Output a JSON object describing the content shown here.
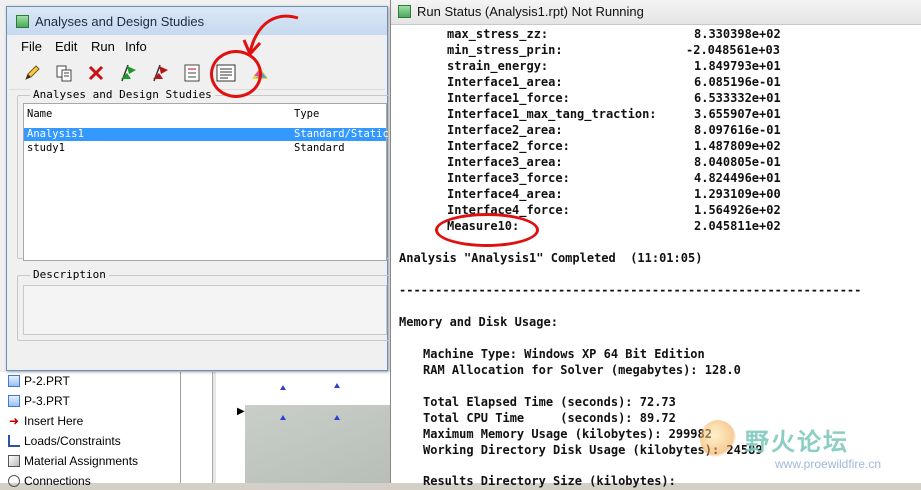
{
  "dialog": {
    "title": "Analyses and Design Studies",
    "menus": [
      "File",
      "Edit",
      "Run",
      "Info"
    ],
    "toolbar_icons": [
      "pencil-icon",
      "copy-icon",
      "delete-icon",
      "green-flag-icon",
      "red-flag-icon",
      "list-icon",
      "status-icon",
      "results-icon"
    ],
    "studies_group_label": "Analyses and Design Studies",
    "columns": [
      "Name",
      "Type"
    ],
    "rows": [
      {
        "name": "Analysis1",
        "type": "Standard/Static",
        "selected": true
      },
      {
        "name": "study1",
        "type": "Standard",
        "selected": false
      }
    ],
    "description_label": "Description"
  },
  "model_tree": {
    "items": [
      {
        "label": "P-2.PRT",
        "icon": "part-icon"
      },
      {
        "label": "P-3.PRT",
        "icon": "part-icon"
      },
      {
        "label": "Insert Here",
        "icon": "insert-arrow-icon"
      },
      {
        "label": "Loads/Constraints",
        "icon": "loads-icon"
      },
      {
        "label": "Material Assignments",
        "icon": "material-icon"
      },
      {
        "label": "Connections",
        "icon": "connections-icon"
      }
    ]
  },
  "run_status": {
    "title": "Run Status (Analysis1.rpt) Not Running",
    "measures": [
      {
        "name": "max_stress_zz:",
        "value": "8.330398e+02"
      },
      {
        "name": "min_stress_prin:",
        "value": "-2.048561e+03"
      },
      {
        "name": "strain_energy:",
        "value": "1.849793e+01"
      },
      {
        "name": "Interface1_area:",
        "value": "6.085196e-01"
      },
      {
        "name": "Interface1_force:",
        "value": "6.533332e+01"
      },
      {
        "name": "Interface1_max_tang_traction:",
        "value": "3.655907e+01"
      },
      {
        "name": "Interface2_area:",
        "value": "8.097616e-01"
      },
      {
        "name": "Interface2_force:",
        "value": "1.487809e+02"
      },
      {
        "name": "Interface3_area:",
        "value": "8.040805e-01"
      },
      {
        "name": "Interface3_force:",
        "value": "4.824496e+01"
      },
      {
        "name": "Interface4_area:",
        "value": "1.293109e+00"
      },
      {
        "name": "Interface4_force:",
        "value": "1.564926e+02"
      },
      {
        "name": "Measure10:",
        "value": "2.045811e+02"
      }
    ],
    "completed_line": "Analysis \"Analysis1\" Completed  (11:01:05)",
    "separator": "----------------------------------------------------------------",
    "memory_heading": "Memory and Disk Usage:",
    "machine_type": "Machine Type: Windows XP 64 Bit Edition",
    "ram_allocation": "RAM Allocation for Solver (megabytes): 128.0",
    "elapsed": "Total Elapsed Time (seconds): 72.73",
    "cpu": "Total CPU Time     (seconds): 89.72",
    "max_memory": "Maximum Memory Usage (kilobytes): 299982",
    "disk_usage": "Working Directory Disk Usage (kilobytes): 24589",
    "results_dir": "Results Directory Size (kilobytes):"
  },
  "watermark": {
    "text": "野火论坛",
    "url": "www.proewildfire.cn"
  },
  "colors": {
    "selection": "#3399ff",
    "annotation": "#e01010",
    "title_bar": "#c6d9ef"
  }
}
